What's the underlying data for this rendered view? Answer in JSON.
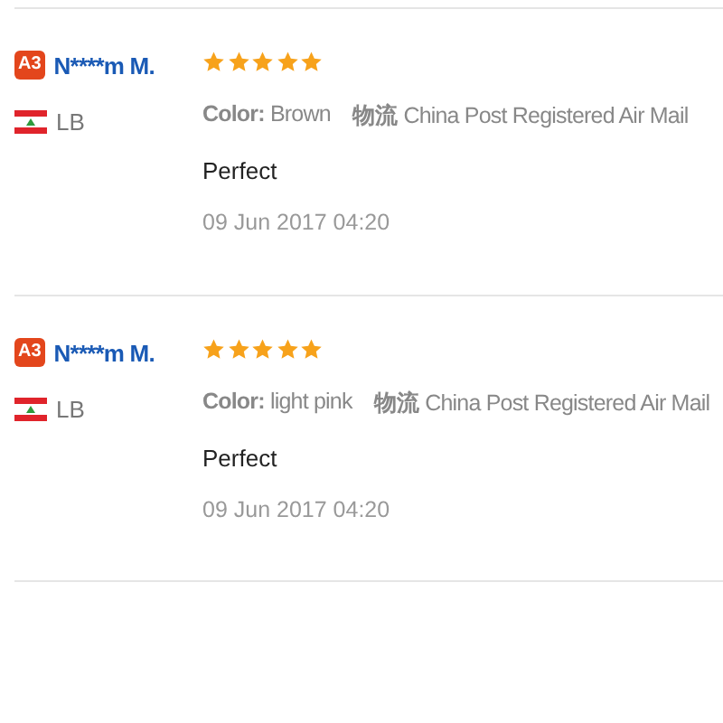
{
  "reviews": [
    {
      "badge": "A3",
      "name": "N****m M.",
      "country": "LB",
      "stars": 5,
      "color_label": "Color:",
      "color_value": "Brown",
      "shipping_label": "物流",
      "shipping": "China Post Registered Air Mail",
      "text": "Perfect",
      "date": "09 Jun 2017 04:20"
    },
    {
      "badge": "A3",
      "name": "N****m M.",
      "country": "LB",
      "stars": 5,
      "color_label": "Color:",
      "color_value": "light pink",
      "shipping_label": "物流",
      "shipping": "China Post Registered Air Mail",
      "text": "Perfect",
      "date": "09 Jun 2017 04:20"
    }
  ]
}
